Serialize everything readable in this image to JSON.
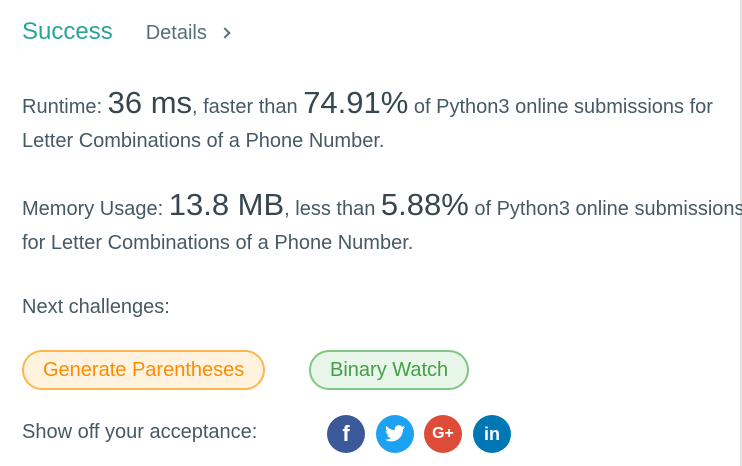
{
  "header": {
    "status": "Success",
    "details_label": "Details"
  },
  "runtime": {
    "label": "Runtime: ",
    "value": "36 ms",
    "comparison": ", faster than ",
    "percent": "74.91%",
    "suffix": " of Python3 online submissions for",
    "problem": "Letter Combinations of a Phone Number."
  },
  "memory": {
    "label": "Memory Usage: ",
    "value": "13.8 MB",
    "comparison": ", less than ",
    "percent": "5.88%",
    "suffix": " of Python3 online submissions",
    "problem": "for Letter Combinations of a Phone Number."
  },
  "next": {
    "label": "Next challenges:",
    "challenges": [
      {
        "label": "Generate Parentheses",
        "accent": "#fb8c00"
      },
      {
        "label": "Binary Watch",
        "accent": "#43a047"
      }
    ]
  },
  "share": {
    "label": "Show off your acceptance:",
    "icons": [
      {
        "name": "facebook-icon",
        "glyph": "f",
        "color": "#3b5998"
      },
      {
        "name": "twitter-icon",
        "glyph": "",
        "color": "#1da1f2"
      },
      {
        "name": "google-plus-icon",
        "glyph": "G+",
        "color": "#dd4b39"
      },
      {
        "name": "linkedin-icon",
        "glyph": "in",
        "color": "#0077b5"
      }
    ]
  },
  "colors": {
    "success": "#26a69a",
    "text": "#455a64"
  }
}
